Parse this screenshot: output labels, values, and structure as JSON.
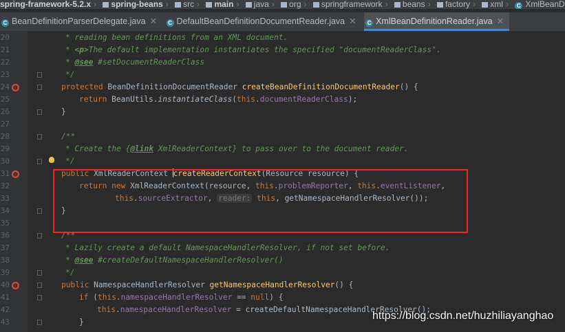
{
  "breadcrumbs": [
    "spring-framework-5.2.x",
    "spring-beans",
    "src",
    "main",
    "java",
    "org",
    "springframework",
    "beans",
    "factory",
    "xml",
    "XmlBeanDefiniti"
  ],
  "tabs": [
    {
      "label": "BeanDefinitionParserDelegate.java",
      "active": false
    },
    {
      "label": "DefaultBeanDefinitionDocumentReader.java",
      "active": false
    },
    {
      "label": "XmlBeanDefinitionReader.java",
      "active": true
    }
  ],
  "line_numbers": [
    "20",
    "21",
    "22",
    "23",
    "24",
    "25",
    "26",
    "27",
    "28",
    "29",
    "30",
    "31",
    "32",
    "33",
    "34",
    "35",
    "36",
    "37",
    "38",
    "39",
    "40",
    "41",
    "42",
    "43"
  ],
  "code": {
    "l20": "* reading bean definitions from an XML document.",
    "l21_pre": "* ",
    "l21_tag": "<p>",
    "l21_post": "The default implementation instantiates the specified \"documentReaderClass\".",
    "l22_pre": "* ",
    "l22_tag": "@see",
    "l22_post": " #setDocumentReaderClass",
    "l23": "*/",
    "l24_kw": "protected",
    "l24_type": " BeanDefinitionDocumentReader ",
    "l24_fn": "createBeanDefinitionDocumentReader",
    "l24_end": "() {",
    "l25_kw": "return",
    "l25_a": " BeanUtils.",
    "l25_m": "instantiateClass",
    "l25_b": "(",
    "l25_this": "this",
    "l25_c": ".",
    "l25_f": "documentReaderClass",
    "l25_d": ");",
    "l26": "}",
    "l28": "/**",
    "l29_pre": "* Create the {",
    "l29_tag": "@link",
    "l29_post": " XmlReaderContext} to pass over to the document reader.",
    "l30": "*/",
    "l31_kw": "public",
    "l31_type": " XmlReaderContext ",
    "l31_fn": "createReaderContext",
    "l31_end": "(Resource resource) {",
    "l32_kw1": "return new",
    "l32_a": " XmlReaderContext(resource, ",
    "l32_this1": "this",
    "l32_dot1": ".",
    "l32_f1": "problemReporter",
    "l32_b": ", ",
    "l32_this2": "this",
    "l32_dot2": ".",
    "l32_f2": "eventListener",
    "l32_c": ",",
    "l33_this1": "this",
    "l33_dot1": ".",
    "l33_f1": "sourceExtractor",
    "l33_a": ", ",
    "l33_hint": "reader:",
    "l33_sp": " ",
    "l33_this2": "this",
    "l33_b": ", getNamespaceHandlerResolver());",
    "l34": "}",
    "l36": "/**",
    "l37": "* Lazily create a default NamespaceHandlerResolver, if not set before.",
    "l38_pre": "* ",
    "l38_tag": "@see",
    "l38_post": " #createDefaultNamespaceHandlerResolver()",
    "l39": "*/",
    "l40_kw": "public",
    "l40_type": " NamespaceHandlerResolver ",
    "l40_fn": "getNamespaceHandlerResolver",
    "l40_end": "() {",
    "l41_kw": "if",
    "l41_a": " (",
    "l41_this": "this",
    "l41_dot": ".",
    "l41_f": "namespaceHandlerResolver",
    "l41_b": " == ",
    "l41_null": "null",
    "l41_c": ") {",
    "l42_this": "this",
    "l42_dot": ".",
    "l42_f": "namespaceHandlerResolver",
    "l42_a": " = createDefaultNamespaceHandlerResolver();",
    "l43": "}"
  },
  "watermark": "https://blog.csdn.net/huzhiliayanghao",
  "colors": {
    "keyword": "#cc7832",
    "method": "#ffc66d",
    "field": "#9876aa",
    "comment": "#629755",
    "highlight_box": "#ff2020"
  }
}
